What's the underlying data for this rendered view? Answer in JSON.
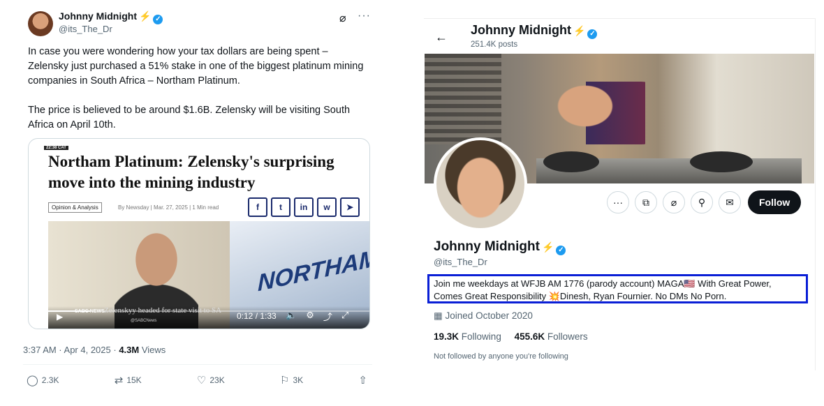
{
  "tweet": {
    "author_name": "Johnny Midnight",
    "author_emoji": "⚡",
    "handle": "@its_The_Dr",
    "grok_icon": "⌀",
    "more_icon": "···",
    "text_p1": "In case you were wondering how your tax dollars are being spent – Zelensky just purchased a 51% stake in one of the biggest platinum mining companies in South Africa – Northam Platinum.",
    "text_p2": "The price is believed to be around $1.6B. Zelensky will be visiting South Africa on April 10th.",
    "card": {
      "time_tag": "22:38 CAT",
      "headline": "Northam Platinum: Zelensky's surprising move into the mining industry",
      "category": "Opinion & Analysis",
      "meta": "By Newsday | Mar. 27, 2025 | 1 Min read",
      "share_icons": [
        "f",
        "t",
        "in",
        "w",
        "➤"
      ],
      "video": {
        "sign_text": "NORTHAM",
        "news_label": "SABC NEWS",
        "caption": "Zelenskyy headed for state visit to SA",
        "sub_caption": "@SABCNews",
        "time": "0:12 / 1:33",
        "progress": 0.13,
        "controls": [
          "🔈",
          "⚙",
          "⤴",
          "⤢"
        ]
      }
    },
    "timestamp": "3:37 AM · Apr 4, 2025 · ",
    "views_count": "4.3M",
    "views_label": " Views",
    "actions": {
      "replies": "2.3K",
      "reposts": "15K",
      "likes": "23K",
      "bookmarks": "3K"
    }
  },
  "profile": {
    "title": "Johnny Midnight",
    "title_emoji": "⚡",
    "posts": "251.4K posts",
    "name": "Johnny Midnight",
    "name_emoji": "⚡",
    "handle": "@its_The_Dr",
    "follow_label": "Follow",
    "bio": "Join me weekdays at WFJB AM 1776 (parody account) MAGA🇺🇸 With Great Power, Comes Great Responsibility 💥Dinesh, Ryan Fournier. No DMs No Porn.",
    "joined": "Joined October 2020",
    "following_count": "19.3K",
    "following_label": "Following",
    "followers_count": "455.6K",
    "followers_label": "Followers",
    "not_followed": "Not followed by anyone you're following"
  },
  "colors": {
    "accent": "#1d9bf0",
    "highlight_border": "#0a1fd6"
  }
}
